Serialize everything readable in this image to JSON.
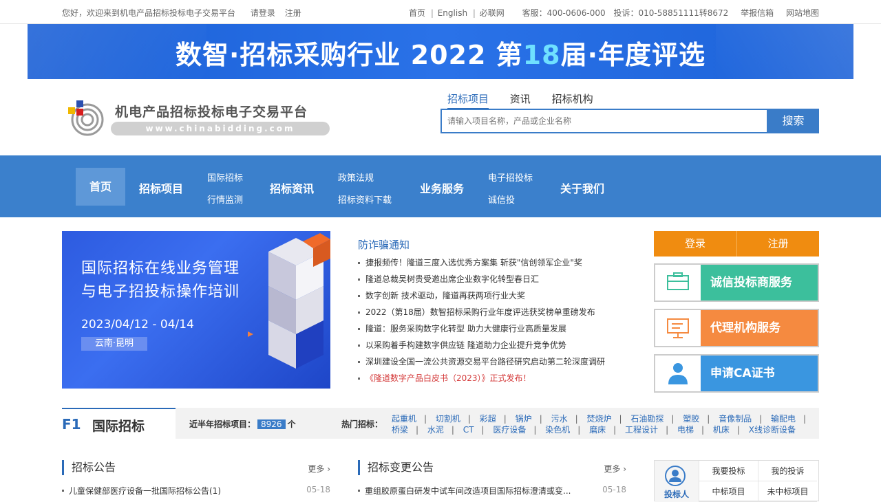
{
  "topbar": {
    "welcome": "您好，欢迎来到机电产品招标投标电子交易平台",
    "login": "请登录",
    "register": "注册",
    "links": [
      "首页",
      "English",
      "必联网"
    ],
    "service_label": "客服：400-0606-000",
    "complaint_label": "投诉：010-58851111转8672",
    "report": "举报信箱",
    "sitemap": "网站地图"
  },
  "banner": {
    "text_a": "数智·招标采购行业  2022 第",
    "text_num": "18",
    "text_b": "届·年度评选"
  },
  "header": {
    "logo_title": "机电产品招标投标电子交易平台",
    "logo_url": "www.chinabidding.com",
    "search_tabs": [
      "招标项目",
      "资讯",
      "招标机构"
    ],
    "search_placeholder": "请输入项目名称，产品或企业名称",
    "search_button": "搜索"
  },
  "nav": {
    "home": "首页",
    "bidding_projects": "招标项目",
    "intl_bidding": "国际招标",
    "market_monitor": "行情监测",
    "bidding_news": "招标资讯",
    "policy": "政策法规",
    "downloads": "招标资料下载",
    "business": "业务服务",
    "e_bidding": "电子招投标",
    "credit_bid": "诚信投",
    "about": "关于我们"
  },
  "focus": {
    "line1": "国际招标在线业务管理",
    "line2": "与电子招投标操作培训",
    "date": "2023/04/12 - 04/14",
    "location": "云南·昆明"
  },
  "news": {
    "heading": "防诈骗通知",
    "items": [
      "捷报频传！隆道三度入选优秀方案集 斩获\"信创领军企业\"奖",
      "隆道总裁吴树贵受邀出席企业数字化转型春日汇",
      "数字创新 技术驱动，隆道再获两项行业大奖",
      "2022（第18届）数智招标采购行业年度评选获奖榜单重磅发布",
      "隆道：服务采购数字化转型 助力大健康行业高质量发展",
      "以采购着手构建数字供应链 隆道助力企业提升竞争优势",
      "深圳建设全国一流公共资源交易平台路径研究启动第二轮深度调研",
      "《隆道数字产品白皮书（2023）》正式发布！"
    ]
  },
  "side": {
    "login": "登录",
    "register": "注册",
    "credit_service": "诚信投标商服务",
    "agency_service": "代理机构服务",
    "ca_cert": "申请CA证书",
    "colors": {
      "green": "#3cbf9c",
      "orange": "#f58a40",
      "blue": "#3a96e0"
    }
  },
  "f1": {
    "num": "F1",
    "title": "国际招标",
    "count_label": "近半年招标项目：",
    "count_value": "8926",
    "count_unit": "个",
    "hot_label": "热门招标：",
    "tags_row1": [
      "起重机",
      "切割机",
      "彩超",
      "锅炉",
      "污水",
      "焚烧炉",
      "石油勘探",
      "塑胶",
      "音像制品",
      "输配电"
    ],
    "tags_row2": [
      "桥梁",
      "水泥",
      "CT",
      "医疗设备",
      "染色机",
      "磨床",
      "工程设计",
      "电梯",
      "机床",
      "X线诊断设备"
    ]
  },
  "lists": {
    "bid_notice": {
      "title": "招标公告",
      "more": "更多",
      "first_item": "儿童保健部医疗设备一批国际招标公告(1)",
      "first_date": "05-18"
    },
    "change_notice": {
      "title": "招标变更公告",
      "more": "更多",
      "first_item": "重组胶原蛋白研发中试车间改造项目国际招标澄清或变...",
      "first_date": "05-18"
    }
  },
  "panel": {
    "role": "投标人",
    "cells": [
      "我要投标",
      "我的投诉",
      "中标项目",
      "未中标项目"
    ]
  }
}
